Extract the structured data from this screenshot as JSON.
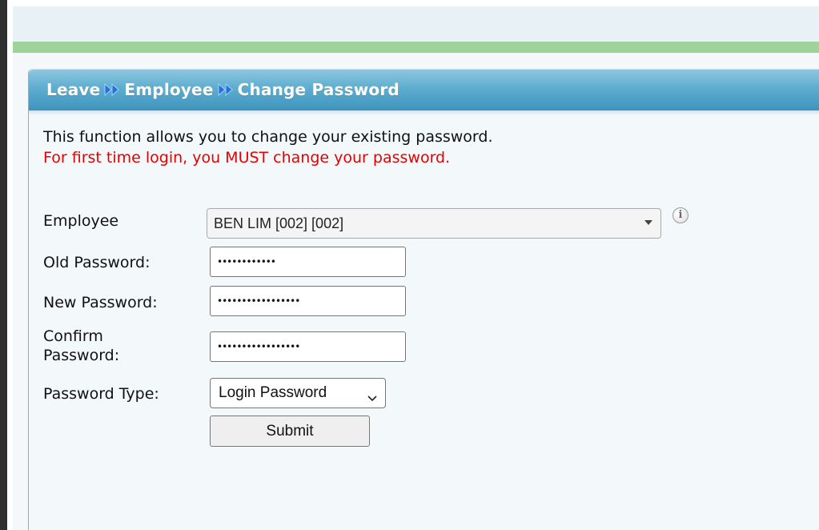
{
  "breadcrumb": {
    "items": [
      "Leave",
      "Employee",
      "Change Password"
    ],
    "separator_icon": "double-right-arrow-icon"
  },
  "description": {
    "line1": "This function allows you to change your existing password.",
    "line2": "For first time login, you MUST change your password."
  },
  "form": {
    "employee_label": "Employee",
    "employee_value": "BEN LIM [002] [002]",
    "info_icon": "info-icon",
    "old_password_label": "Old Password:",
    "old_password_value": "••••••••••••",
    "new_password_label": "New Password:",
    "new_password_value": "•••••••••••••••••",
    "confirm_password_label_line1": "Confirm",
    "confirm_password_label_line2": "Password:",
    "confirm_password_value": "•••••••••••••••••",
    "password_type_label": "Password Type:",
    "password_type_value": "Login Password",
    "submit_label": "Submit"
  },
  "colors": {
    "header_blue": "#4fa3c9",
    "top_green_bar": "#9ed39a",
    "warning_red": "#e60000"
  }
}
